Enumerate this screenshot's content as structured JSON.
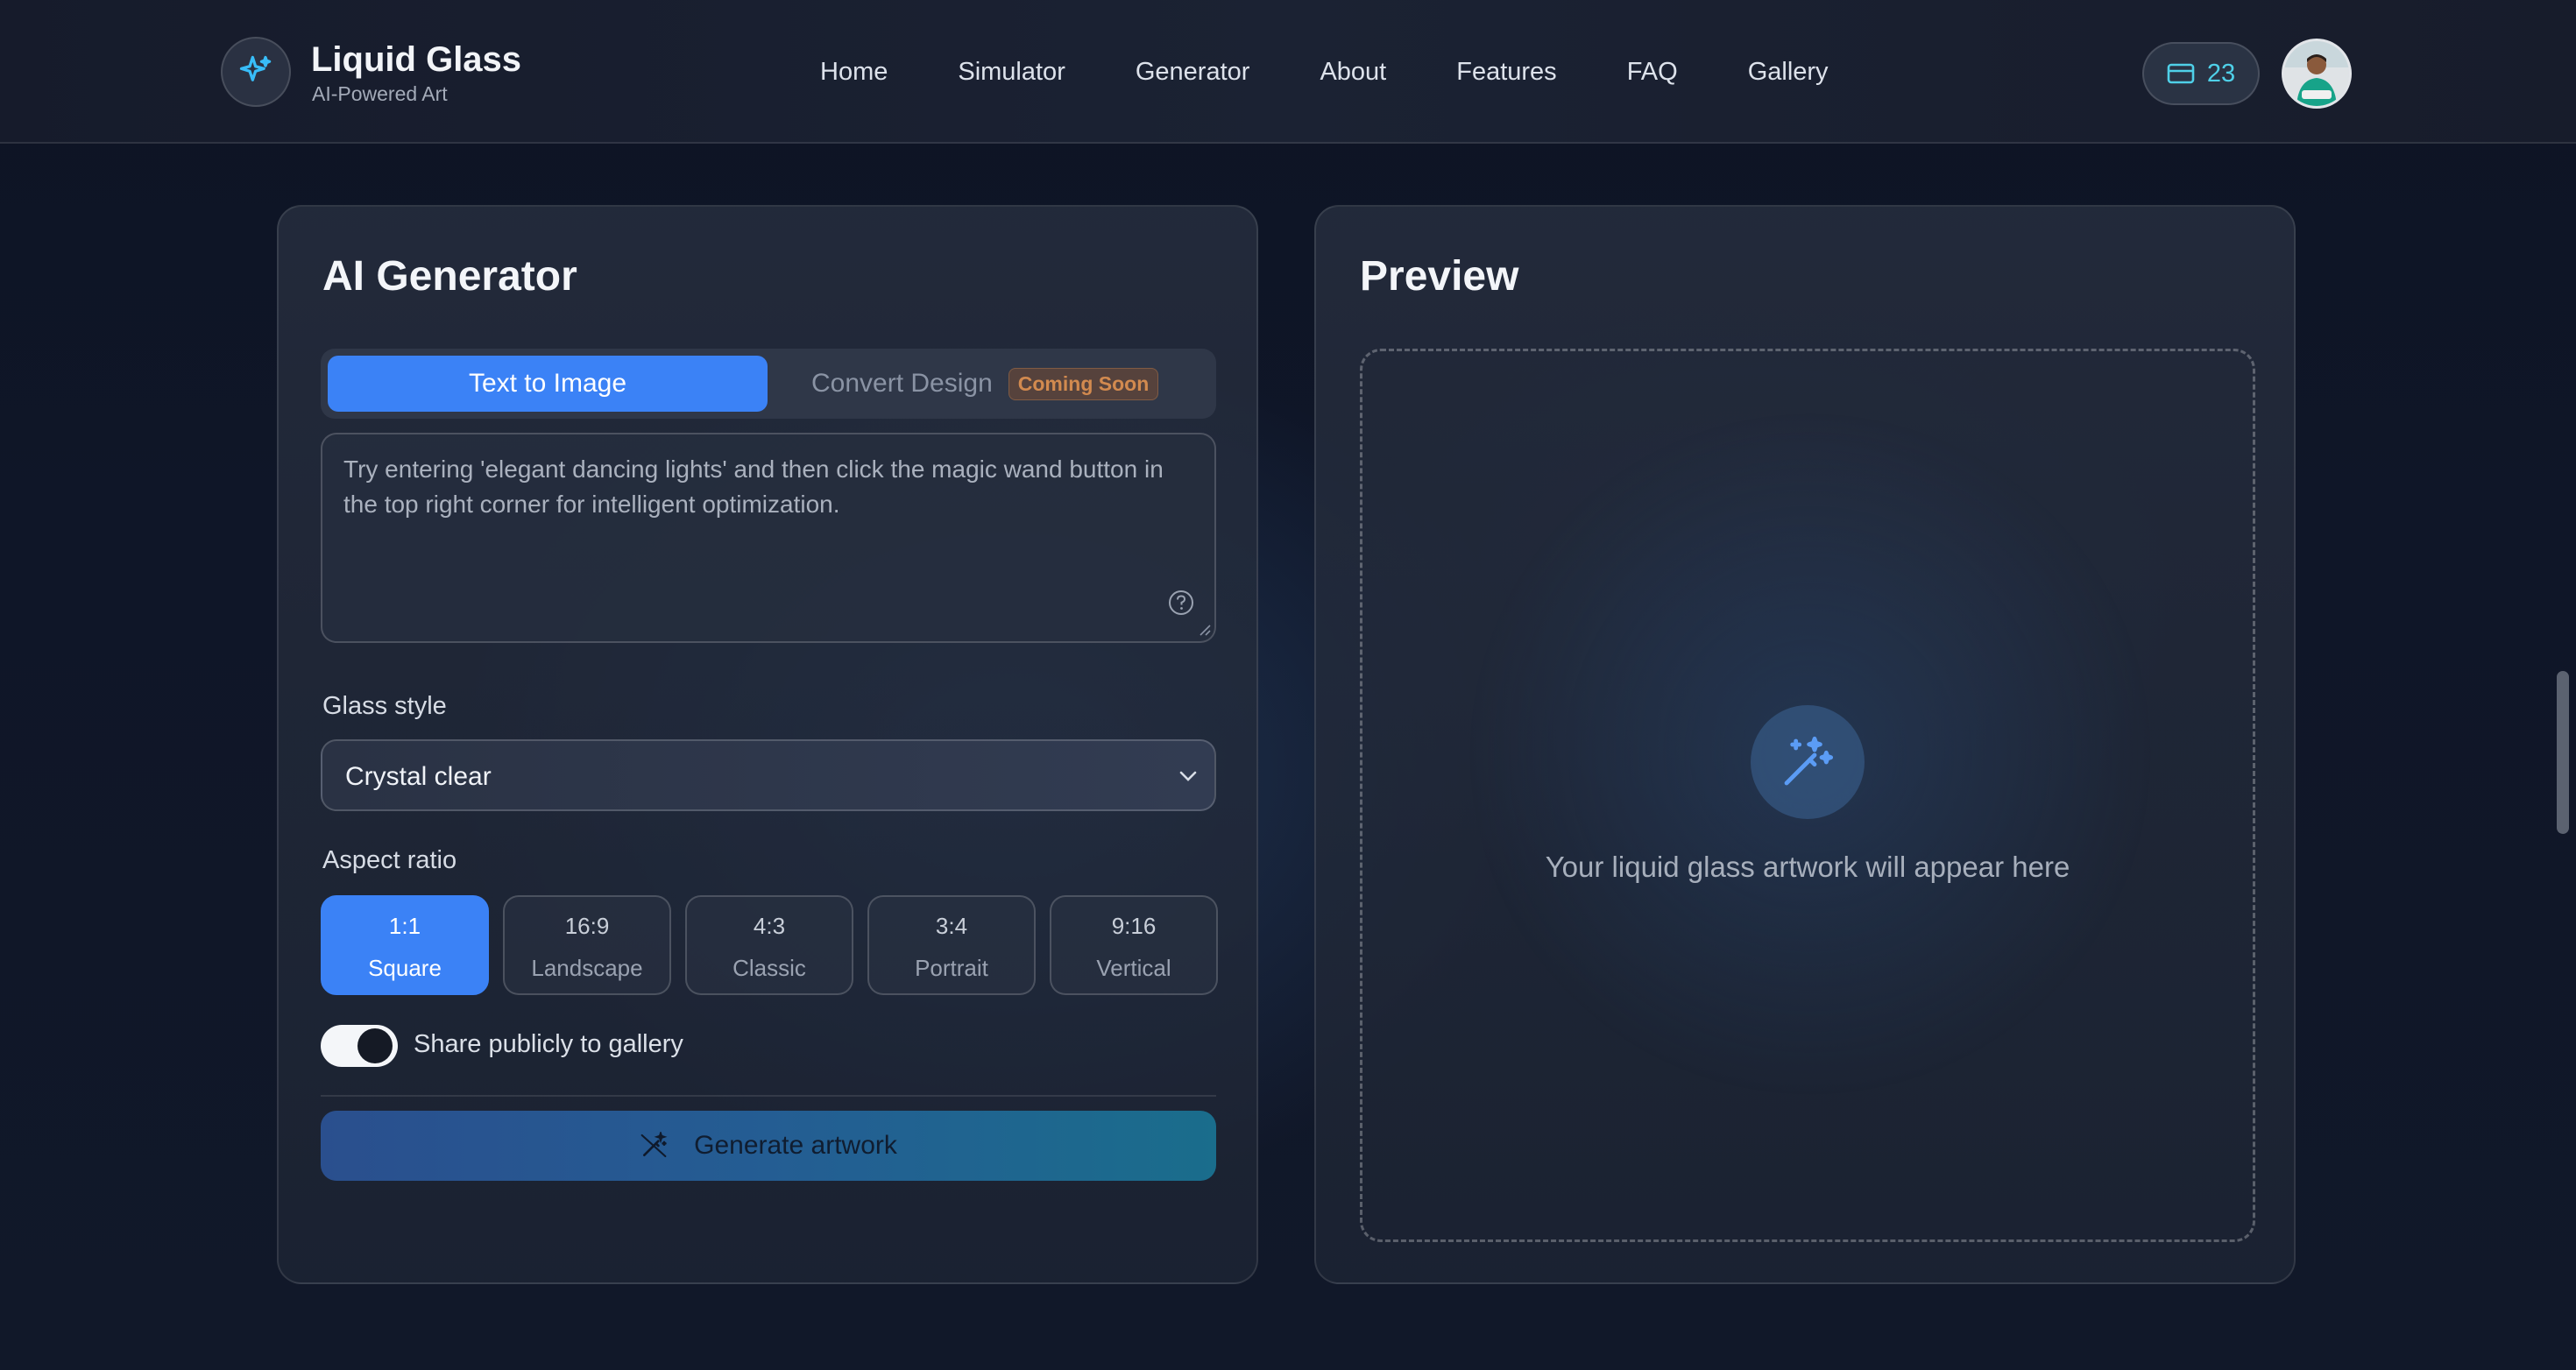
{
  "header": {
    "brand_title": "Liquid Glass",
    "brand_subtitle": "AI-Powered Art",
    "logo_icon": "sparkle-icon",
    "nav": [
      "Home",
      "Simulator",
      "Generator",
      "About",
      "Features",
      "FAQ",
      "Gallery"
    ],
    "credits": "23",
    "credits_icon": "credit-card-icon"
  },
  "generator": {
    "title": "AI Generator",
    "tabs": {
      "active": "Text to Image",
      "inactive": "Convert Design",
      "badge": "Coming Soon"
    },
    "prompt_placeholder": "Try entering 'elegant dancing lights' and then click the magic wand button in the top right corner for intelligent optimization.",
    "style_label": "Glass style",
    "style_value": "Crystal clear",
    "ratio_label": "Aspect ratio",
    "ratios": [
      {
        "ratio": "1:1",
        "name": "Square",
        "selected": true
      },
      {
        "ratio": "16:9",
        "name": "Landscape",
        "selected": false
      },
      {
        "ratio": "4:3",
        "name": "Classic",
        "selected": false
      },
      {
        "ratio": "3:4",
        "name": "Portrait",
        "selected": false
      },
      {
        "ratio": "9:16",
        "name": "Vertical",
        "selected": false
      }
    ],
    "share_label": "Share publicly to gallery",
    "share_enabled": true,
    "generate_label": "Generate artwork"
  },
  "preview": {
    "title": "Preview",
    "empty_text": "Your liquid glass artwork will appear here",
    "icon": "magic-wand-icon"
  },
  "colors": {
    "accent": "#3b82f6",
    "credits_text": "#4fd0e8",
    "badge_text": "#d28a4f"
  }
}
